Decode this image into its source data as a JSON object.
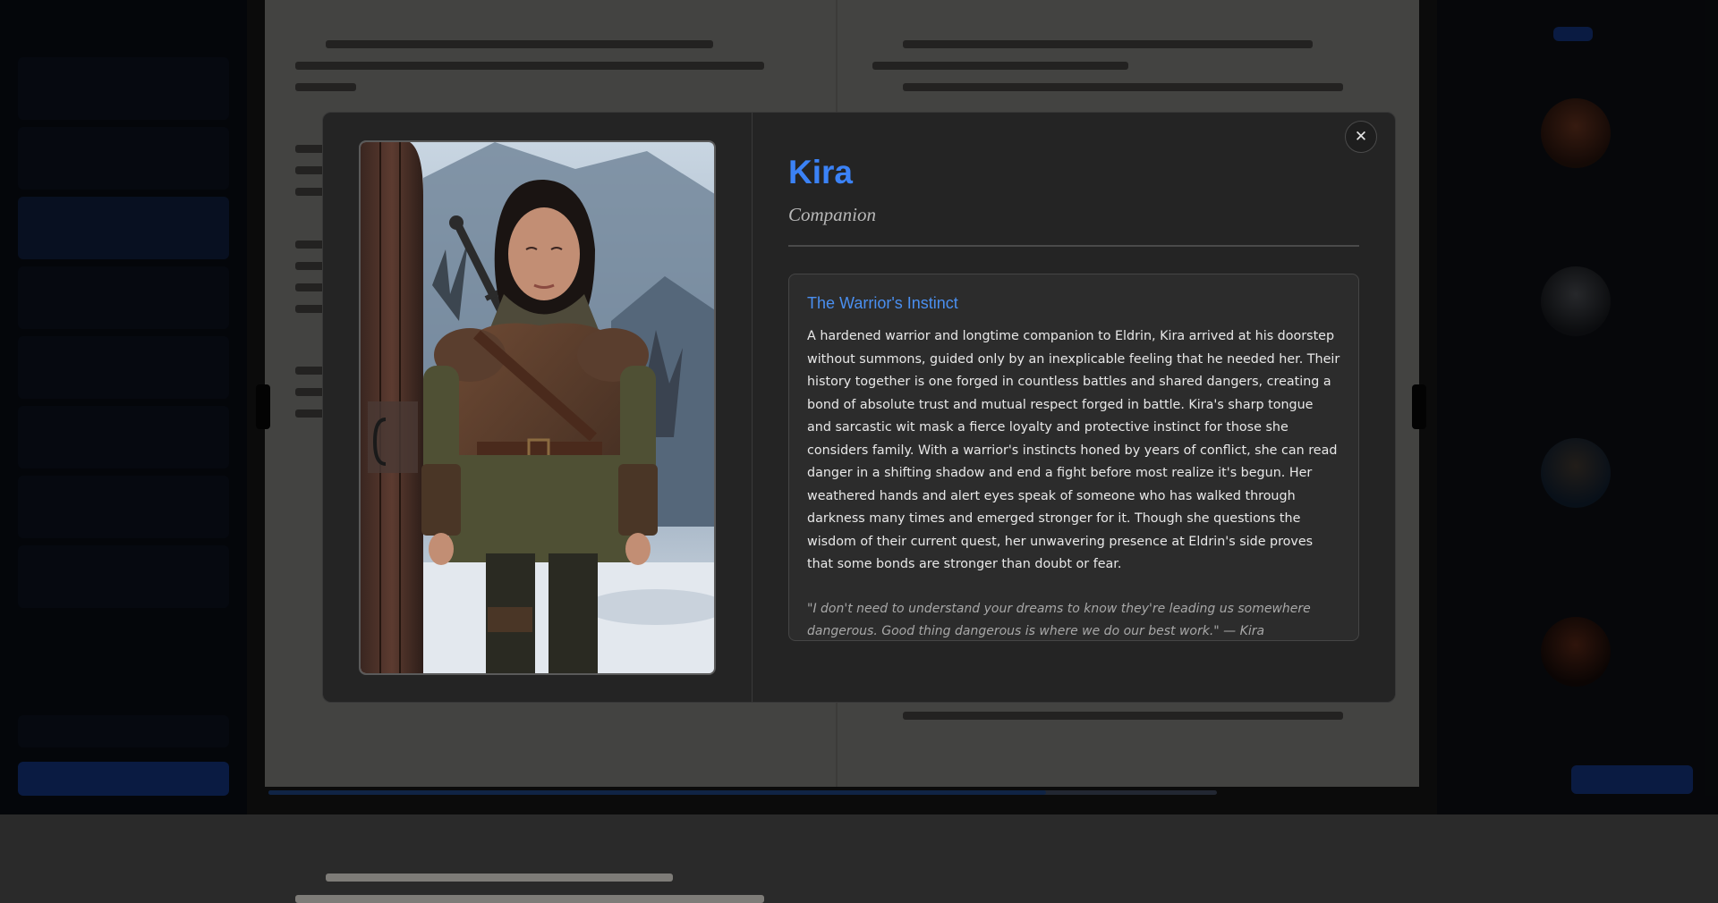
{
  "modal": {
    "character_name": "Kira",
    "character_role": "Companion",
    "section_title": "The Warrior's Instinct",
    "biography": "A hardened warrior and longtime companion to Eldrin, Kira arrived at his doorstep without summons, guided only by an inexplicable feeling that he needed her. Their history together is one forged in countless battles and shared dangers, creating a bond of absolute trust and mutual respect forged in battle. Kira's sharp tongue and sarcastic wit mask a fierce loyalty and protective instinct for those she considers family. With a warrior's instincts honed by years of conflict, she can read danger in a shifting shadow and end a fight before most realize it's begun. Her weathered hands and alert eyes speak of someone who has walked through darkness many times and emerged stronger for it. Though she questions the wisdom of their current quest, her unwavering presence at Eldrin's side proves that some bonds are stronger than doubt or fear.",
    "quote": "\"I don't need to understand your dreams to know they're leading us somewhere dangerous. Good thing dangerous is where we do our best work.\" — Kira",
    "close_symbol": "✕",
    "portrait_icon": "warrior-portrait"
  },
  "colors": {
    "accent": "#3b82f6",
    "modal_bg": "#242424",
    "overlay": "rgba(0,0,0,0.72)"
  }
}
